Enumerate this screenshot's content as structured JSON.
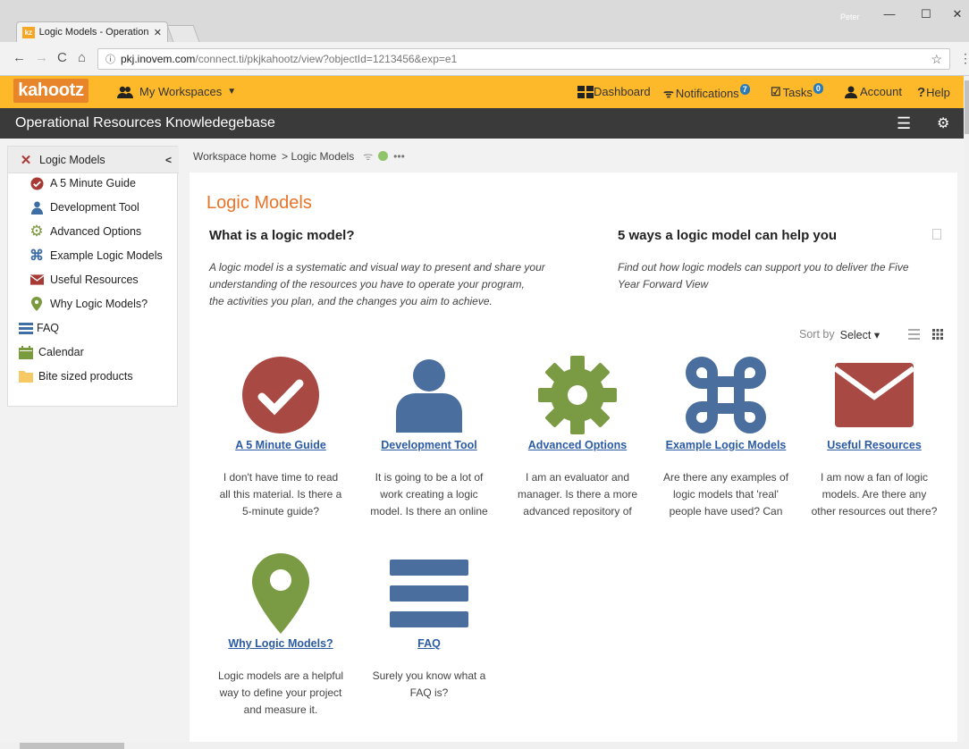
{
  "browser": {
    "tab_title": "Logic Models - Operation",
    "tab_favicon": "kz",
    "user": "Peter",
    "url_host": "pkj.inovem.com",
    "url_path": "/connect.ti/pkjkahootz/view?objectId=1213456&exp=e1"
  },
  "topbar": {
    "logo": "kahootz",
    "workspaces": "My Workspaces",
    "dashboard": "Dashboard",
    "notifications": "Notifications",
    "notifications_count": "7",
    "tasks": "Tasks",
    "tasks_count": "0",
    "account": "Account",
    "help": "Help",
    "accent": "#fdb92a"
  },
  "workspace": {
    "title": "Operational Resources Knowledegebase"
  },
  "sidebar": {
    "items": [
      {
        "label": "Logic Models",
        "icon": "close-x-icon"
      },
      {
        "label": "A 5 Minute Guide",
        "icon": "check-circle-icon"
      },
      {
        "label": "Development Tool",
        "icon": "user-icon"
      },
      {
        "label": "Advanced Options",
        "icon": "gear-icon"
      },
      {
        "label": "Example Logic Models",
        "icon": "command-icon"
      },
      {
        "label": "Useful Resources",
        "icon": "envelope-icon"
      },
      {
        "label": "Why Logic Models?",
        "icon": "map-marker-icon"
      },
      {
        "label": "FAQ",
        "icon": "bars-icon"
      },
      {
        "label": "Calendar",
        "icon": "calendar-icon"
      },
      {
        "label": "Bite sized products",
        "icon": "folder-icon"
      }
    ]
  },
  "breadcrumb": {
    "home": "Workspace home",
    "current": "> Logic Models"
  },
  "main": {
    "title": "Logic Models",
    "what_heading": "What is a logic model?",
    "what_lines": [
      "A logic model is a systematic and visual way to present and share your",
      "understanding of the resources you have to operate your program,",
      "the activities you plan, and the changes you aim to achieve."
    ],
    "five_heading": "5 ways a logic model can help you",
    "five_lines": [
      "Find out how logic models can support you to deliver the Five",
      "Year Forward View"
    ],
    "sort_by": "Sort by",
    "sort_select": "Select"
  },
  "cards": [
    {
      "title": "A 5 Minute Guide",
      "lines": [
        "I don't have time to read",
        "all this material. Is there a",
        "5-minute guide?"
      ]
    },
    {
      "title": "Development Tool",
      "lines": [
        "It is going to be a lot of",
        "work creating a logic",
        "model. Is there an online"
      ]
    },
    {
      "title": "Advanced Options",
      "lines": [
        "I am an evaluator and",
        "manager. Is there a more",
        "advanced repository of"
      ]
    },
    {
      "title": "Example Logic Models",
      "lines": [
        "Are there any examples of",
        "logic models that 'real'",
        "people have used? Can"
      ]
    },
    {
      "title": "Useful Resources",
      "lines": [
        "I am now a fan of logic",
        "models. Are there any",
        "other resources out there?"
      ]
    },
    {
      "title": "Why Logic Models?",
      "lines": [
        "Logic models are a helpful",
        "way to define your project",
        "and measure it."
      ]
    },
    {
      "title": "FAQ",
      "lines": [
        "Surely you know what a",
        "FAQ is?"
      ]
    }
  ]
}
